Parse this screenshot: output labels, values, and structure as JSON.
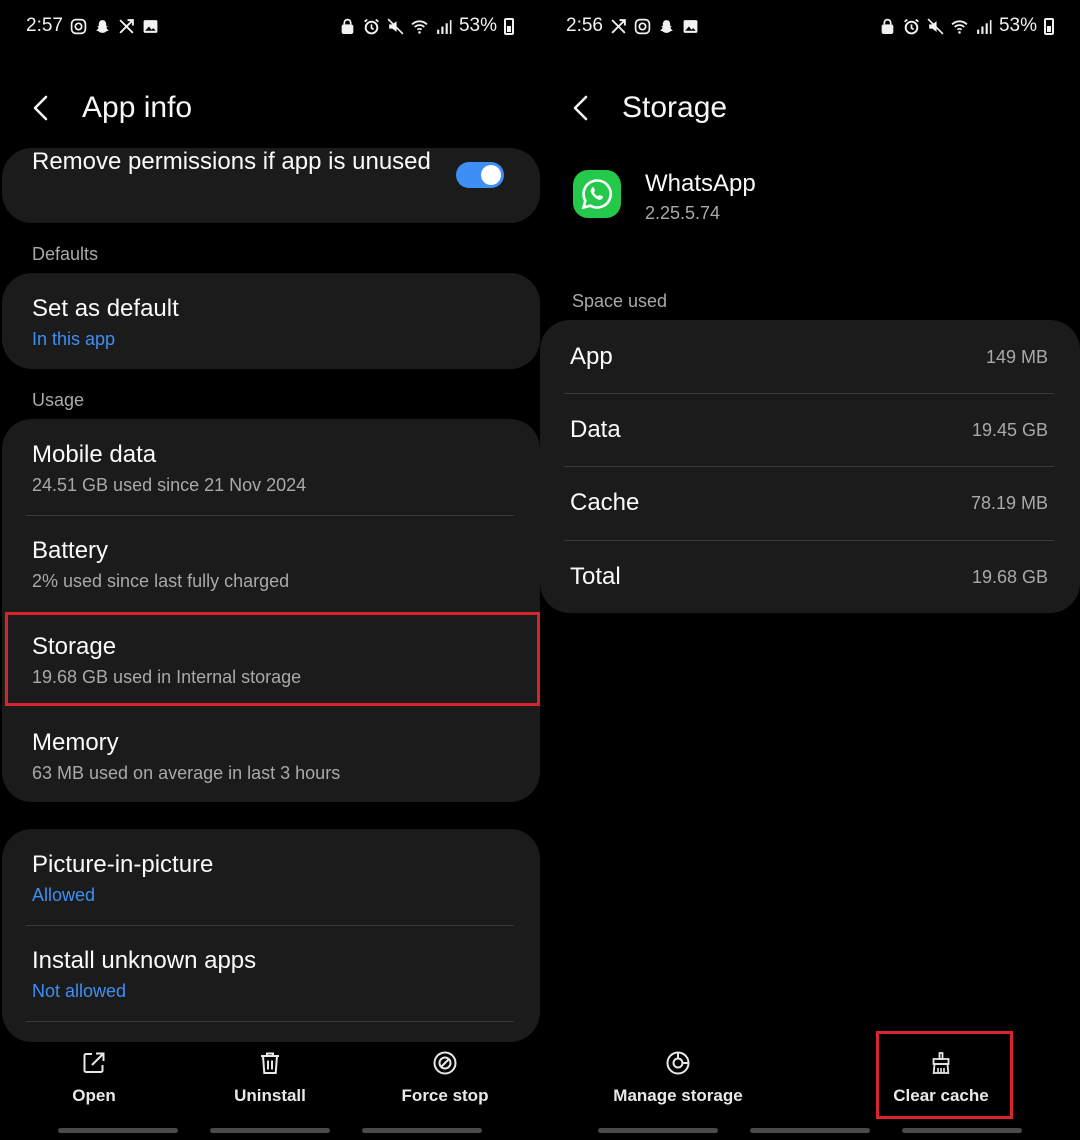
{
  "left": {
    "status": {
      "time": "2:57",
      "battery": "53%"
    },
    "header": {
      "title": "App info"
    },
    "permissions_row": {
      "title": "Remove permissions if app is unused",
      "toggle_on": true
    },
    "sections": {
      "defaults": "Defaults",
      "usage": "Usage"
    },
    "set_default": {
      "title": "Set as default",
      "sub": "In this app"
    },
    "mobile_data": {
      "title": "Mobile data",
      "sub": "24.51 GB used since 21 Nov 2024"
    },
    "battery": {
      "title": "Battery",
      "sub": "2% used since last fully charged"
    },
    "storage": {
      "title": "Storage",
      "sub": "19.68 GB used in Internal storage"
    },
    "memory": {
      "title": "Memory",
      "sub": "63 MB used on average in last 3 hours"
    },
    "pip": {
      "title": "Picture-in-picture",
      "sub": "Allowed"
    },
    "unknown_apps": {
      "title": "Install unknown apps",
      "sub": "Not allowed"
    },
    "toolbar": {
      "open": "Open",
      "uninstall": "Uninstall",
      "force_stop": "Force stop"
    }
  },
  "right": {
    "status": {
      "time": "2:56",
      "battery": "53%"
    },
    "header": {
      "title": "Storage"
    },
    "app": {
      "name": "WhatsApp",
      "version": "2.25.5.74"
    },
    "space_label": "Space used",
    "space": [
      {
        "label": "App",
        "value": "149 MB"
      },
      {
        "label": "Data",
        "value": "19.45 GB"
      },
      {
        "label": "Cache",
        "value": "78.19 MB"
      },
      {
        "label": "Total",
        "value": "19.68 GB"
      }
    ],
    "toolbar": {
      "manage": "Manage storage",
      "clear": "Clear cache"
    }
  },
  "colors": {
    "accent": "#3e8ff5",
    "highlight": "#d9232e",
    "card": "#1b1b1b",
    "whatsapp": "#24c94b"
  }
}
